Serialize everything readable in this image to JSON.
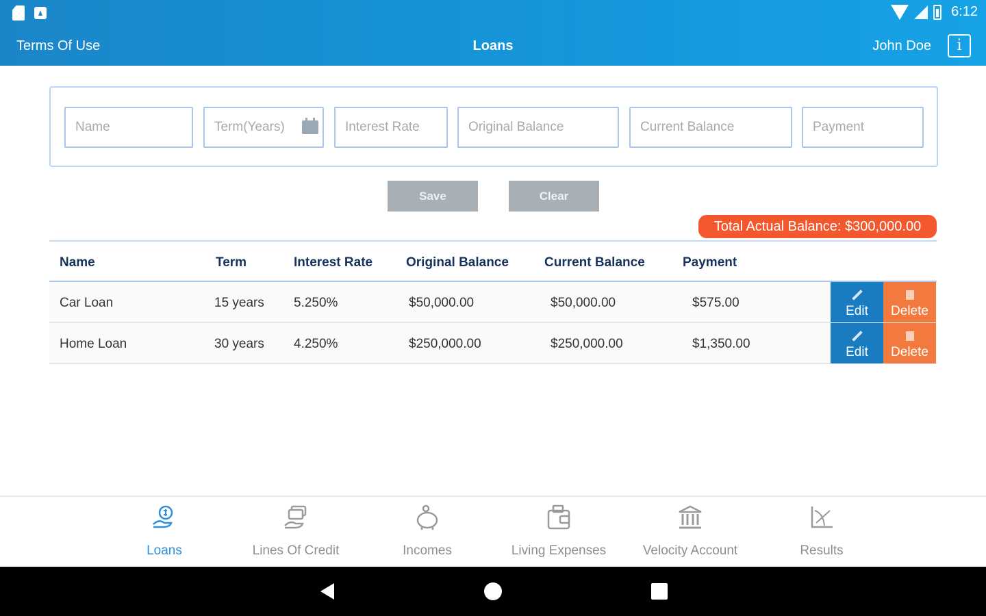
{
  "statusbar": {
    "time": "6:12"
  },
  "header": {
    "terms_label": "Terms Of Use",
    "title": "Loans",
    "user_name": "John Doe",
    "info_glyph": "i"
  },
  "form": {
    "name_placeholder": "Name",
    "term_placeholder": "Term(Years)",
    "rate_placeholder": "Interest Rate",
    "original_placeholder": "Original Balance",
    "current_placeholder": "Current Balance",
    "payment_placeholder": "Payment",
    "save_label": "Save",
    "clear_label": "Clear"
  },
  "total_balance": "Total Actual Balance: $300,000.00",
  "table": {
    "columns": [
      "Name",
      "Term",
      "Interest Rate",
      "Original Balance",
      "Current Balance",
      "Payment"
    ],
    "rows": [
      {
        "name": "Car Loan",
        "term": "15 years",
        "rate": "5.250%",
        "original": "$50,000.00",
        "current": "$50,000.00",
        "payment": "$575.00",
        "edit_label": "Edit",
        "delete_label": "Delete"
      },
      {
        "name": "Home Loan",
        "term": "30 years",
        "rate": "4.250%",
        "original": "$250,000.00",
        "current": "$250,000.00",
        "payment": "$1,350.00",
        "edit_label": "Edit",
        "delete_label": "Delete"
      }
    ]
  },
  "bottom_nav": {
    "items": [
      {
        "label": "Loans",
        "icon": "hand-coin-icon",
        "active": true
      },
      {
        "label": "Lines Of Credit",
        "icon": "hand-cards-icon",
        "active": false
      },
      {
        "label": "Incomes",
        "icon": "piggy-bank-icon",
        "active": false
      },
      {
        "label": "Living Expenses",
        "icon": "wallet-icon",
        "active": false
      },
      {
        "label": "Velocity Account",
        "icon": "bank-icon",
        "active": false
      },
      {
        "label": "Results",
        "icon": "chart-icon",
        "active": false
      }
    ]
  },
  "colors": {
    "header_blue": "#1597dc",
    "total_badge": "#f2572e",
    "edit_button": "#1a7cc0",
    "delete_button": "#f37a3f",
    "active_nav": "#2a8fe0"
  }
}
